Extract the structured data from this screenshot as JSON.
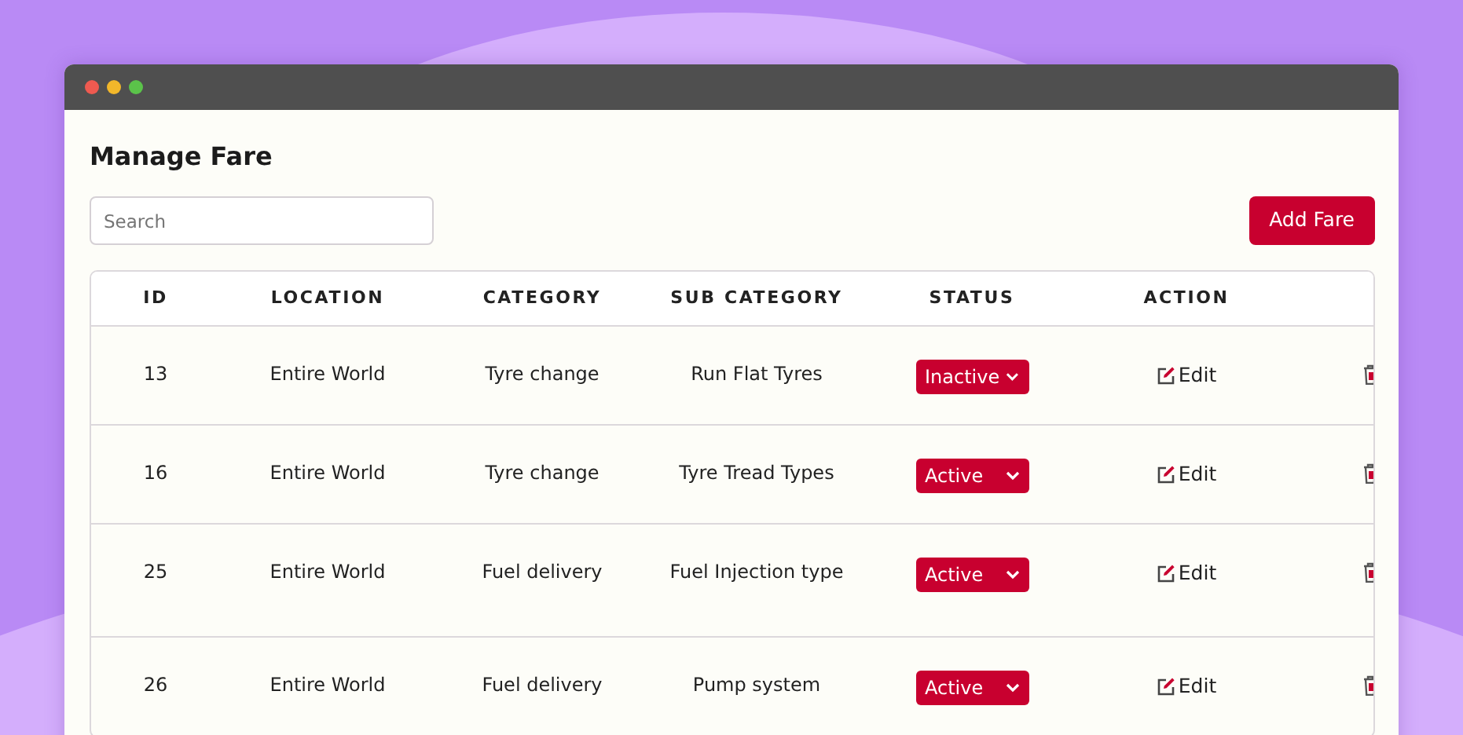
{
  "page": {
    "title": "Manage Fare"
  },
  "search": {
    "placeholder": "Search"
  },
  "add_button": "Add Fare",
  "table": {
    "columns": [
      "ID",
      "LOCATION",
      "CATEGORY",
      "SUB CATEGORY",
      "STATUS",
      "ACTION"
    ],
    "rows": [
      {
        "id": "13",
        "location": "Entire World",
        "category": "Tyre change",
        "sub_category": "Run Flat Tyres",
        "status": "Inactive",
        "action": "Edit"
      },
      {
        "id": "16",
        "location": "Entire World",
        "category": "Tyre change",
        "sub_category": "Tyre Tread Types",
        "status": "Active",
        "action": "Edit"
      },
      {
        "id": "25",
        "location": "Entire World",
        "category": "Fuel delivery",
        "sub_category": "Fuel Injection type",
        "status": "Active",
        "action": "Edit"
      },
      {
        "id": "26",
        "location": "Entire World",
        "category": "Fuel delivery",
        "sub_category": "Pump system",
        "status": "Active",
        "action": "Edit"
      }
    ]
  }
}
